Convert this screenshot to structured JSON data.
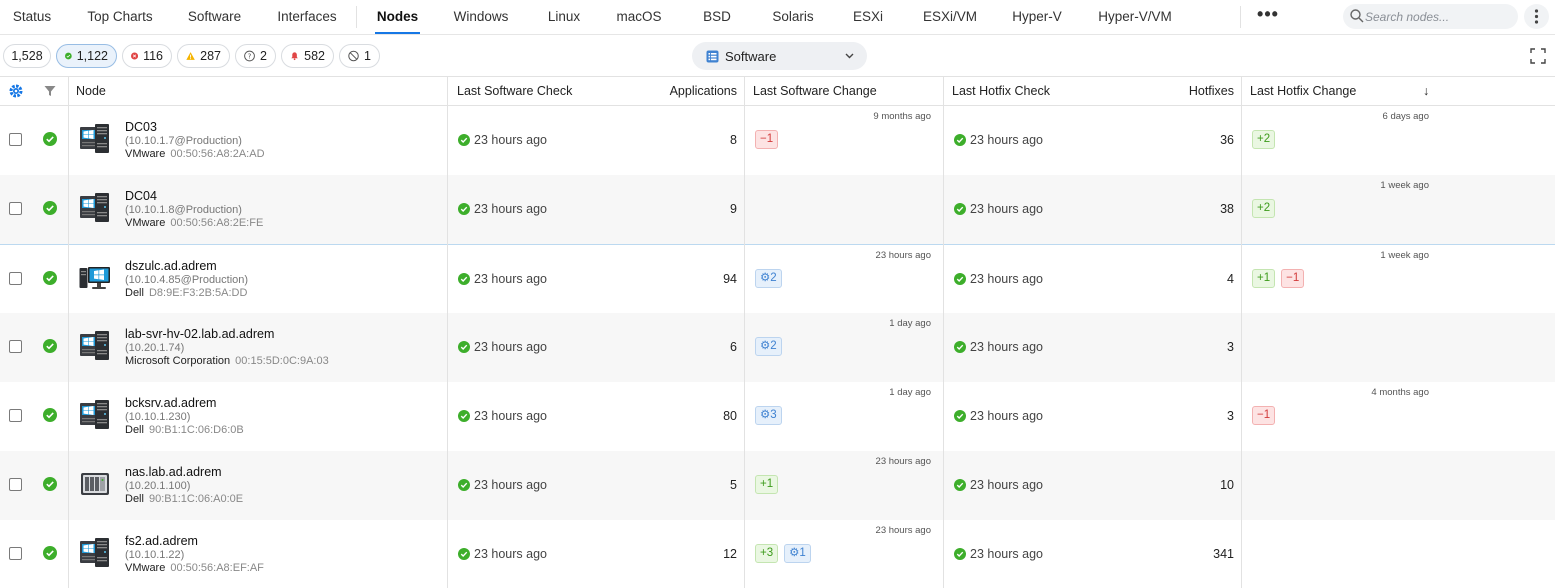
{
  "topnav": {
    "tabs": [
      {
        "label": "Status",
        "active": false
      },
      {
        "label": "Top Charts",
        "active": false
      },
      {
        "label": "Software",
        "active": false
      },
      {
        "label": "Interfaces",
        "active": false
      },
      {
        "label": "Nodes",
        "active": true
      },
      {
        "label": "Windows",
        "active": false
      },
      {
        "label": "Linux",
        "active": false
      },
      {
        "label": "macOS",
        "active": false
      },
      {
        "label": "BSD",
        "active": false
      },
      {
        "label": "Solaris",
        "active": false
      },
      {
        "label": "ESXi",
        "active": false
      },
      {
        "label": "ESXi/VM",
        "active": false
      },
      {
        "label": "Hyper-V",
        "active": false
      },
      {
        "label": "Hyper-V/VM",
        "active": false
      }
    ],
    "more_label": "•••",
    "search_placeholder": "Search nodes...",
    "search_value": ""
  },
  "filters": {
    "all": "1,528",
    "ok": "1,122",
    "error": "116",
    "warning": "287",
    "unknown": "2",
    "alerts": "582",
    "disabled": "1"
  },
  "view_select": {
    "label": "Software"
  },
  "colors": {
    "accent": "#1677e5",
    "ok": "#3dae2b",
    "error": "#e04545",
    "warning": "#f5b400"
  },
  "table": {
    "headers": {
      "node": "Node",
      "last_software_check": "Last Software Check",
      "applications": "Applications",
      "last_software_change": "Last Software Change",
      "last_hotfix_check": "Last Hotfix Check",
      "hotfixes": "Hotfixes",
      "last_hotfix_change": "Last Hotfix Change",
      "sort_indicator": "↓"
    },
    "rows": [
      {
        "name": "DC03",
        "addr": "(10.10.1.7@Production)",
        "vendor": "VMware",
        "mac": "00:50:56:A8:2A:AD",
        "icon": "windows-server-icon",
        "sw_check": "23 hours ago",
        "apps": "8",
        "sw_change_ago": "9 months ago",
        "sw_badges": [
          {
            "text": "−1",
            "kind": "red"
          }
        ],
        "hf_check": "23 hours ago",
        "hotfixes": "36",
        "hf_change_ago": "6 days ago",
        "hf_badges": [
          {
            "text": "+2",
            "kind": "green"
          }
        ]
      },
      {
        "name": "DC04",
        "addr": "(10.10.1.8@Production)",
        "vendor": "VMware",
        "mac": "00:50:56:A8:2E:FE",
        "icon": "windows-server-icon",
        "sw_check": "23 hours ago",
        "apps": "9",
        "sw_change_ago": "",
        "sw_badges": [],
        "hf_check": "23 hours ago",
        "hotfixes": "38",
        "hf_change_ago": "1 week ago",
        "hf_badges": [
          {
            "text": "+2",
            "kind": "green"
          }
        ]
      },
      {
        "name": "dszulc.ad.adrem",
        "addr": "(10.10.4.85@Production)",
        "vendor": "Dell",
        "mac": "D8:9E:F3:2B:5A:DD",
        "icon": "windows-desktop-icon",
        "sw_check": "23 hours ago",
        "apps": "94",
        "sw_change_ago": "23 hours ago",
        "sw_badges": [
          {
            "text": "⚙2",
            "kind": "blue"
          }
        ],
        "hf_check": "23 hours ago",
        "hotfixes": "4",
        "hf_change_ago": "1 week ago",
        "hf_badges": [
          {
            "text": "+1",
            "kind": "green"
          },
          {
            "text": "−1",
            "kind": "red"
          }
        ]
      },
      {
        "name": "lab-svr-hv-02.lab.ad.adrem",
        "addr": "(10.20.1.74)",
        "vendor": "Microsoft Corporation",
        "mac": "00:15:5D:0C:9A:03",
        "icon": "windows-server-icon",
        "sw_check": "23 hours ago",
        "apps": "6",
        "sw_change_ago": "1 day ago",
        "sw_badges": [
          {
            "text": "⚙2",
            "kind": "blue"
          }
        ],
        "hf_check": "23 hours ago",
        "hotfixes": "3",
        "hf_change_ago": "",
        "hf_badges": []
      },
      {
        "name": "bcksrv.ad.adrem",
        "addr": "(10.10.1.230)",
        "vendor": "Dell",
        "mac": "90:B1:1C:06:D6:0B",
        "icon": "windows-server-icon",
        "sw_check": "23 hours ago",
        "apps": "80",
        "sw_change_ago": "1 day ago",
        "sw_badges": [
          {
            "text": "⚙3",
            "kind": "blue"
          }
        ],
        "hf_check": "23 hours ago",
        "hotfixes": "3",
        "hf_change_ago": "4 months ago",
        "hf_badges": [
          {
            "text": "−1",
            "kind": "red"
          }
        ]
      },
      {
        "name": "nas.lab.ad.adrem",
        "addr": "(10.20.1.100)",
        "vendor": "Dell",
        "mac": "90:B1:1C:06:A0:0E",
        "icon": "nas-device-icon",
        "sw_check": "23 hours ago",
        "apps": "5",
        "sw_change_ago": "23 hours ago",
        "sw_badges": [
          {
            "text": "+1",
            "kind": "green"
          }
        ],
        "hf_check": "23 hours ago",
        "hotfixes": "10",
        "hf_change_ago": "",
        "hf_badges": []
      },
      {
        "name": "fs2.ad.adrem",
        "addr": "(10.10.1.22)",
        "vendor": "VMware",
        "mac": "00:50:56:A8:EF:AF",
        "icon": "windows-server-icon",
        "sw_check": "23 hours ago",
        "apps": "12",
        "sw_change_ago": "23 hours ago",
        "sw_badges": [
          {
            "text": "+3",
            "kind": "green"
          },
          {
            "text": "⚙1",
            "kind": "blue"
          }
        ],
        "hf_check": "23 hours ago",
        "hotfixes": "341",
        "hf_change_ago": "",
        "hf_badges": []
      }
    ]
  }
}
